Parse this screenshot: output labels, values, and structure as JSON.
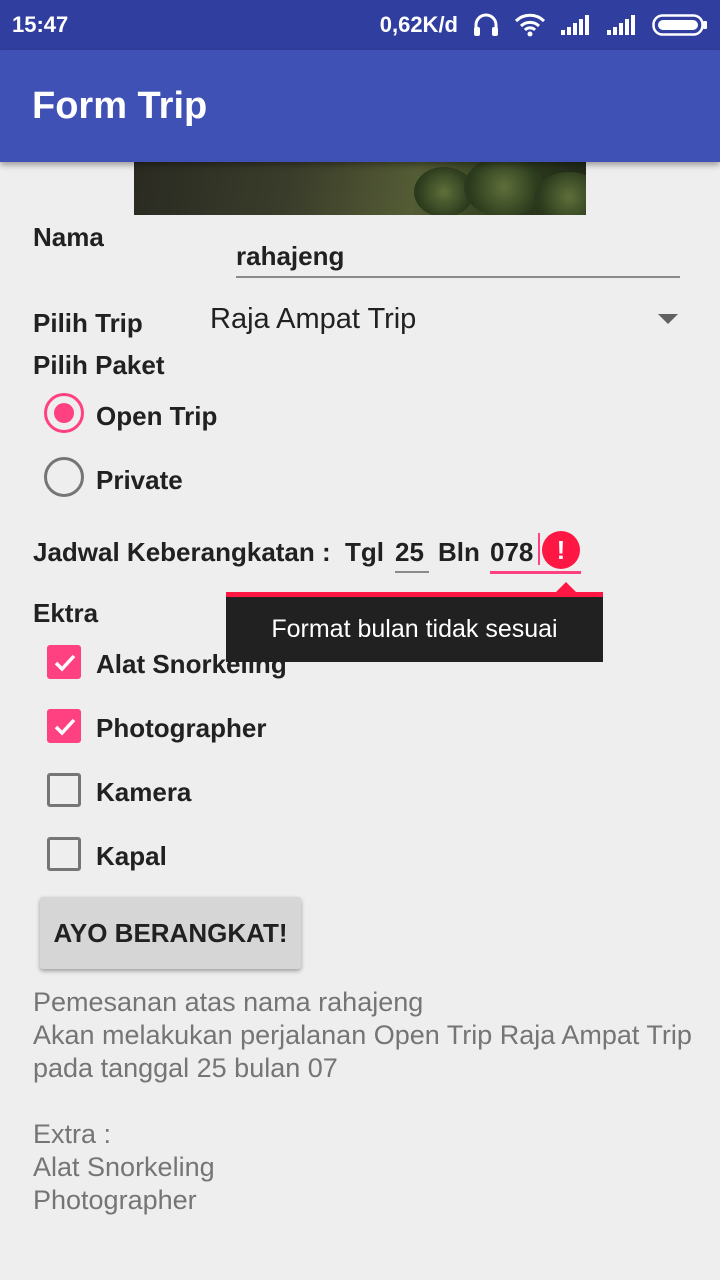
{
  "status_bar": {
    "time": "15:47",
    "network_speed": "0,62K/d",
    "icons": [
      "headphones-icon",
      "wifi-icon",
      "signal-icon",
      "signal-icon",
      "battery-icon"
    ]
  },
  "app_bar": {
    "title": "Form Trip"
  },
  "form": {
    "nama_label": "Nama",
    "nama_value": "rahajeng",
    "trip_label": "Pilih Trip",
    "trip_selected": "Raja Ampat Trip",
    "paket_label": "Pilih Paket",
    "paket_options": [
      {
        "label": "Open Trip",
        "checked": true
      },
      {
        "label": "Private",
        "checked": false
      }
    ],
    "jadwal_label": "Jadwal Keberangkatan :",
    "tgl_label": "Tgl",
    "tgl_value": "25",
    "bln_label": "Bln",
    "bln_value": "078",
    "error_message": "Format bulan tidak sesuai",
    "ekstra_label": "Ektra",
    "ekstra_options": [
      {
        "label": "Alat Snorkeling",
        "checked": true
      },
      {
        "label": "Photographer",
        "checked": true
      },
      {
        "label": "Kamera",
        "checked": false
      },
      {
        "label": "Kapal",
        "checked": false
      }
    ],
    "submit_label": "AYO BERANGKAT!"
  },
  "result": {
    "line1": "Pemesanan atas nama rahajeng",
    "line2": "Akan melakukan perjalanan Open Trip Raja Ampat Trip pada tanggal 25 bulan 07",
    "extra_header": "Extra :",
    "extra_items": [
      "Alat Snorkeling",
      "Photographer"
    ]
  },
  "colors": {
    "primary": "#3f51b5",
    "primary_dark": "#303f9f",
    "accent": "#ff4081",
    "error": "#ff1744"
  }
}
